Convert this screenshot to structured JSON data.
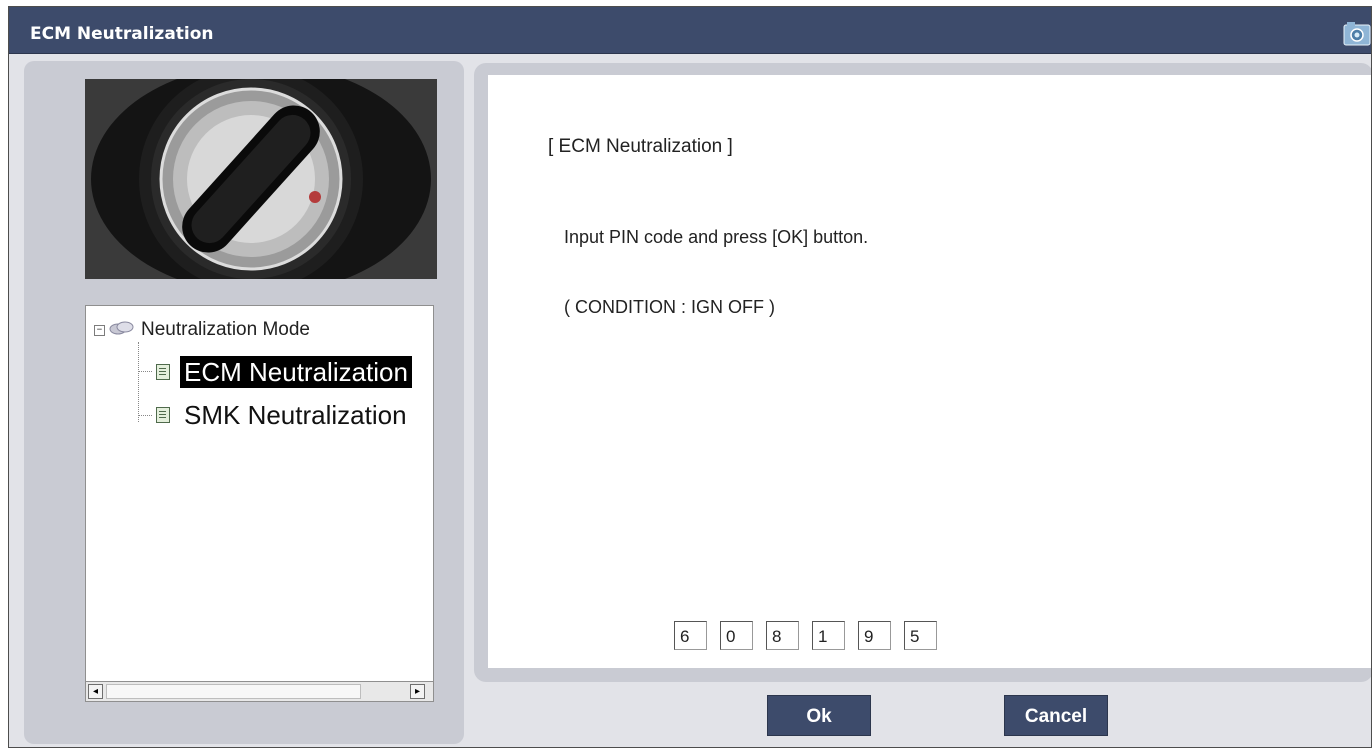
{
  "window": {
    "title": "ECM Neutralization"
  },
  "tree": {
    "root_label": "Neutralization Mode",
    "items": [
      {
        "label": "ECM Neutralization",
        "selected": true
      },
      {
        "label": "SMK Neutralization",
        "selected": false
      }
    ]
  },
  "scrollbar": {
    "left_arrow": "◂",
    "right_arrow": "▸"
  },
  "panel": {
    "title": "[ ECM Neutralization ]",
    "instruction": "Input PIN code and press [OK] button.",
    "condition": "( CONDITION : IGN OFF )",
    "pin_digits": [
      "6",
      "0",
      "8",
      "1",
      "9",
      "5"
    ]
  },
  "buttons": {
    "ok_label": "Ok",
    "cancel_label": "Cancel"
  },
  "colors": {
    "titlebar": "#3d4b6b",
    "panel_frame": "#c9cbd3",
    "selection": "#000000",
    "button": "#3d4b6b"
  },
  "icons": [
    "camera-icon",
    "expand-collapse-icon",
    "group-icon",
    "document-icon"
  ]
}
